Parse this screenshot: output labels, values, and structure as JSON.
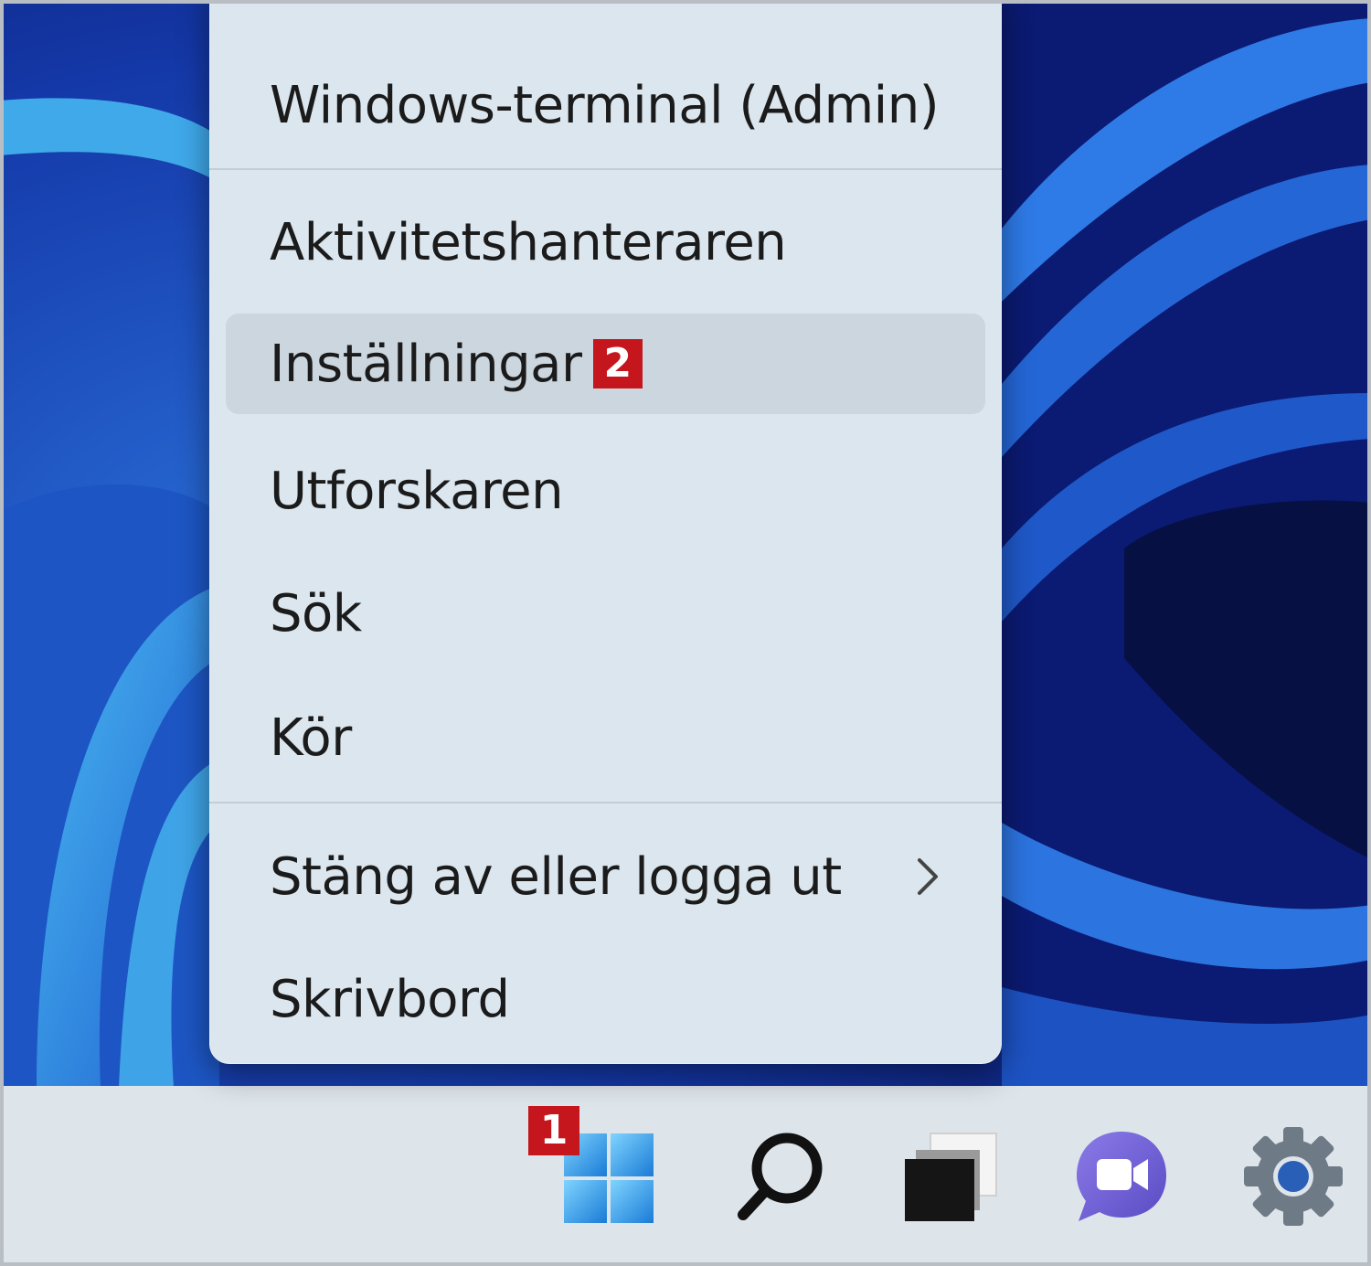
{
  "context_menu": {
    "items": [
      {
        "label": "Windows-terminal (Admin)"
      },
      {
        "label": "Aktivitetshanteraren"
      },
      {
        "label": "Inställningar",
        "badge": "2",
        "highlighted": true
      },
      {
        "label": "Utforskaren"
      },
      {
        "label": "Sök"
      },
      {
        "label": "Kör"
      },
      {
        "label": "Stäng av eller logga ut",
        "submenu_icon": "chevron-right-icon"
      },
      {
        "label": "Skrivbord"
      }
    ]
  },
  "taskbar": {
    "start_badge": "1",
    "icons": [
      "start-icon",
      "search-icon",
      "task-view-icon",
      "chat-icon",
      "settings-icon"
    ]
  },
  "colors": {
    "badge": "#c4161c",
    "menu_background": "#dbe6ee",
    "taskbar_background": "#dde4ea"
  }
}
